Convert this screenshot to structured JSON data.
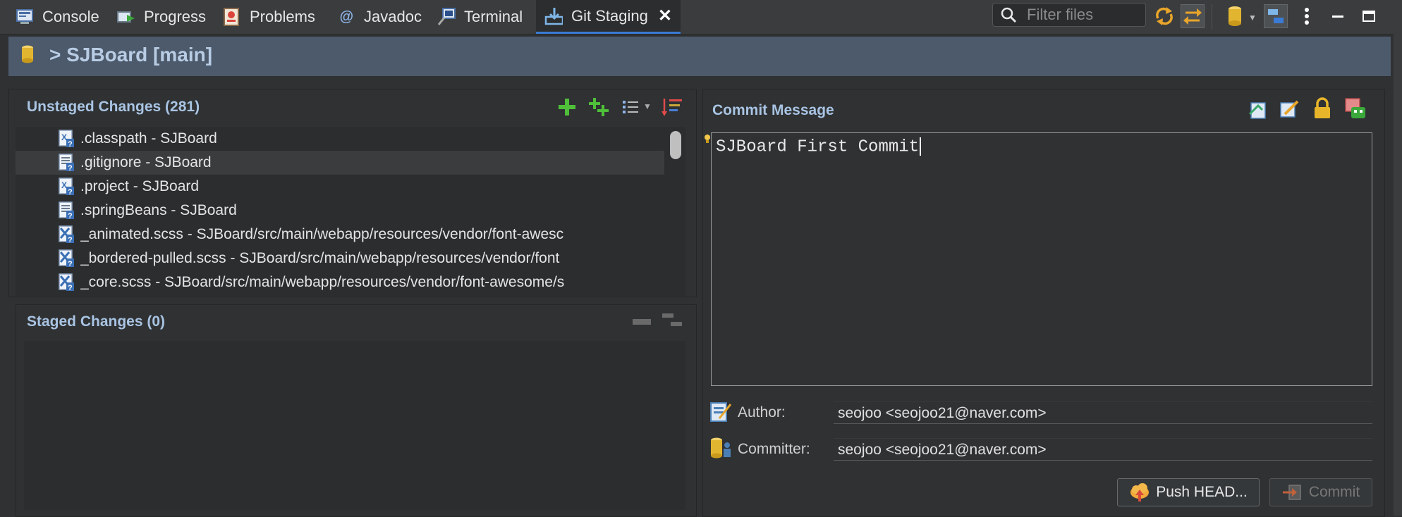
{
  "tabs": [
    {
      "label": "Console",
      "icon": "console-icon"
    },
    {
      "label": "Progress",
      "icon": "progress-icon"
    },
    {
      "label": "Problems",
      "icon": "problems-icon"
    },
    {
      "label": "Javadoc",
      "icon": "javadoc-icon"
    },
    {
      "label": "Terminal",
      "icon": "terminal-icon"
    },
    {
      "label": "Git Staging",
      "icon": "git-staging-icon",
      "active": true
    }
  ],
  "toolbar": {
    "filter_placeholder": "Filter files"
  },
  "repo": {
    "title": "> SJBoard [main]"
  },
  "unstaged": {
    "header": "Unstaged Changes (281)",
    "files": [
      {
        "name": ".classpath - SJBoard",
        "icon": "xml-file-unknown-icon"
      },
      {
        "name": ".gitignore - SJBoard",
        "icon": "text-file-unknown-icon"
      },
      {
        "name": ".project - SJBoard",
        "icon": "xml-file-unknown-icon"
      },
      {
        "name": ".springBeans - SJBoard",
        "icon": "text-file-unknown-icon"
      },
      {
        "name": "_animated.scss - SJBoard/src/main/webapp/resources/vendor/font-awesc",
        "icon": "scss-file-unknown-icon"
      },
      {
        "name": "_bordered-pulled.scss - SJBoard/src/main/webapp/resources/vendor/font",
        "icon": "scss-file-unknown-icon"
      },
      {
        "name": "_core.scss - SJBoard/src/main/webapp/resources/vendor/font-awesome/s",
        "icon": "scss-file-unknown-icon"
      }
    ]
  },
  "staged": {
    "header": "Staged Changes (0)"
  },
  "commit": {
    "header": "Commit Message",
    "message": "SJBoard First Commit",
    "author_label": "Author:",
    "author_value": "seojoo <seojoo21@naver.com>",
    "committer_label": "Committer:",
    "committer_value": "seojoo <seojoo21@naver.com>",
    "push_label": "Push HEAD...",
    "commit_label": "Commit"
  },
  "colors": {
    "accent": "#3a7bd5",
    "header_text": "#a9c4e3",
    "repo_bar": "#4c5a6b"
  }
}
